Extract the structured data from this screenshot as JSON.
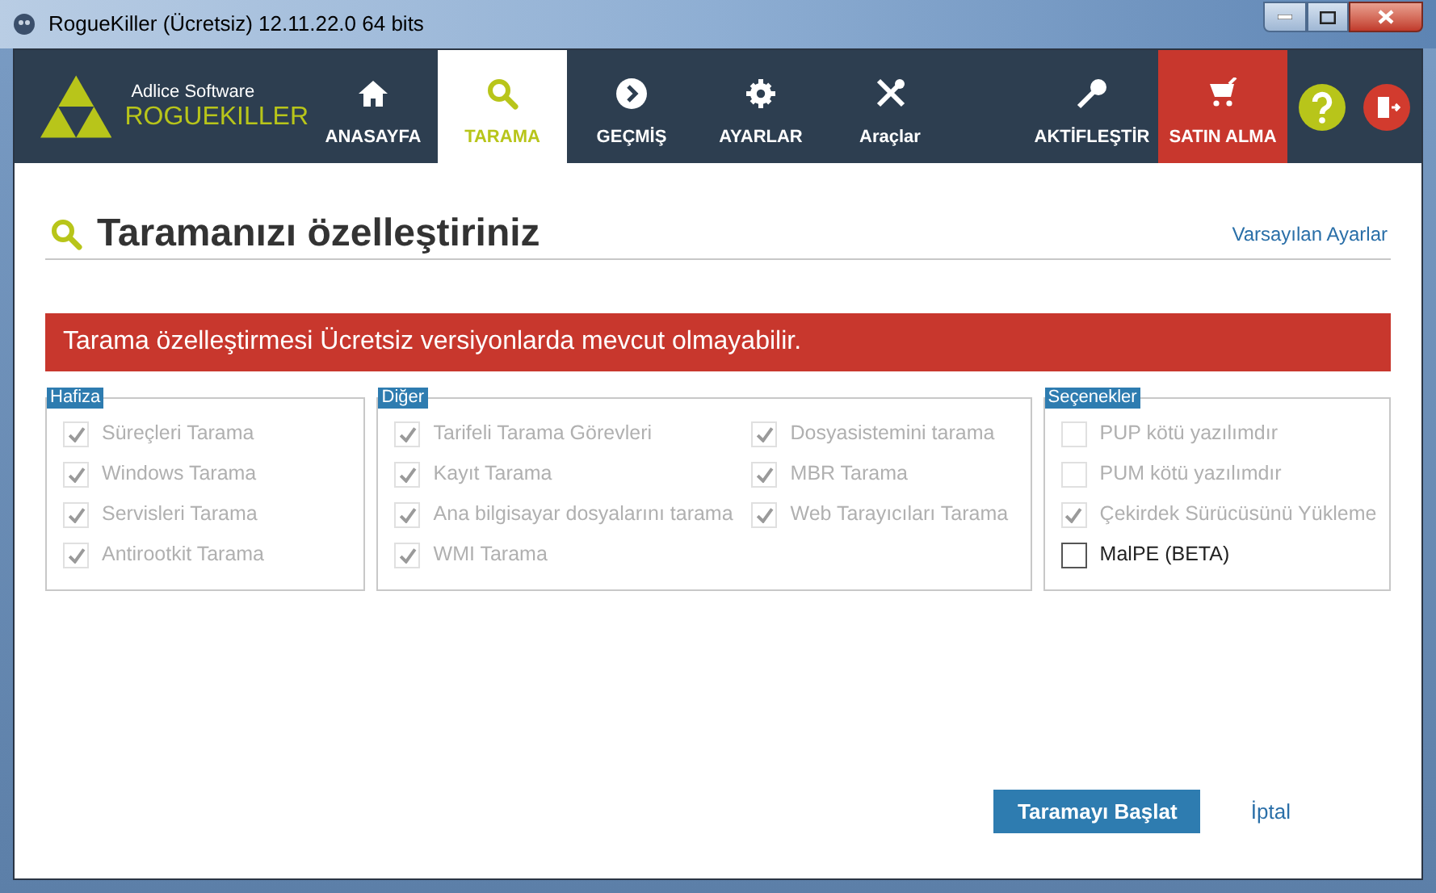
{
  "window": {
    "title": "RogueKiller (Ücretsiz) 12.11.22.0 64 bits"
  },
  "logo": {
    "company": "Adlice Software",
    "product": "ROGUEKILLER"
  },
  "nav": {
    "tabs": [
      {
        "label": "ANASAYFA",
        "selected": false
      },
      {
        "label": "TARAMA",
        "selected": true
      },
      {
        "label": "GEÇMİŞ",
        "selected": false
      },
      {
        "label": "AYARLAR",
        "selected": false
      },
      {
        "label": "Araçlar",
        "selected": false
      }
    ],
    "right_tabs": [
      {
        "label": "AKTİFLEŞTİR",
        "kind": "plain"
      },
      {
        "label": "SATIN ALMA",
        "kind": "buy"
      }
    ]
  },
  "heading": "Taramanızı özelleştiriniz",
  "defaults_link": "Varsayılan Ayarlar",
  "banner": "Tarama özelleştirmesi Ücretsiz versiyonlarda mevcut olmayabilir.",
  "groups": [
    {
      "title": "Hafiza",
      "columns": [
        [
          {
            "label": "Süreçleri Tarama",
            "checked": true,
            "disabled": true
          },
          {
            "label": "Windows Tarama",
            "checked": true,
            "disabled": true
          },
          {
            "label": "Servisleri Tarama",
            "checked": true,
            "disabled": true
          },
          {
            "label": "Antirootkit Tarama",
            "checked": true,
            "disabled": true
          }
        ]
      ]
    },
    {
      "title": "Diğer",
      "columns": [
        [
          {
            "label": "Tarifeli Tarama Görevleri",
            "checked": true,
            "disabled": true
          },
          {
            "label": "Kayıt Tarama",
            "checked": true,
            "disabled": true
          },
          {
            "label": "Ana bilgisayar dosyalarını tarama",
            "checked": true,
            "disabled": true
          },
          {
            "label": "WMI Tarama",
            "checked": true,
            "disabled": true
          }
        ],
        [
          {
            "label": "Dosyasistemini tarama",
            "checked": true,
            "disabled": true
          },
          {
            "label": "MBR Tarama",
            "checked": true,
            "disabled": true
          },
          {
            "label": "Web Tarayıcıları Tarama",
            "checked": true,
            "disabled": true
          }
        ]
      ]
    },
    {
      "title": "Seçenekler",
      "columns": [
        [
          {
            "label": "PUP kötü yazılımdır",
            "checked": false,
            "disabled": true
          },
          {
            "label": "PUM kötü yazılımdır",
            "checked": false,
            "disabled": true
          },
          {
            "label": "Çekirdek Sürücüsünü Yükleme",
            "checked": true,
            "disabled": true
          },
          {
            "label": "MalPE (BETA)",
            "checked": false,
            "disabled": false
          }
        ]
      ]
    }
  ],
  "buttons": {
    "start": "Taramayı Başlat",
    "cancel": "İptal"
  }
}
